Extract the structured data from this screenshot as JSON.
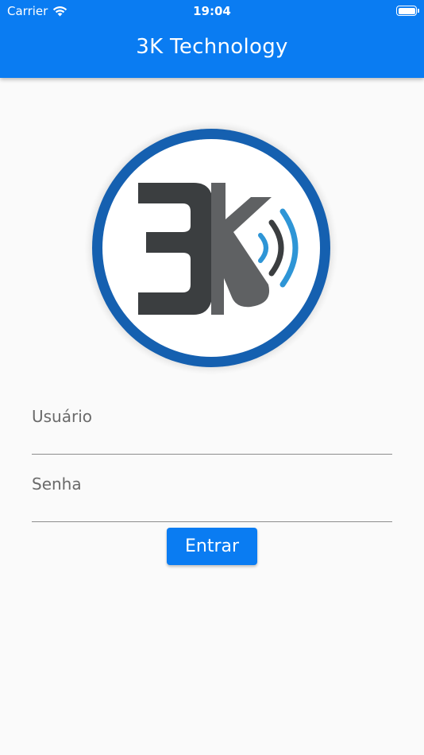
{
  "status_bar": {
    "carrier": "Carrier",
    "time": "19:04",
    "wifi_icon": "wifi-icon",
    "battery_icon": "battery-icon"
  },
  "app_bar": {
    "title": "3K Technology"
  },
  "logo": {
    "text": "3K",
    "icon": "logo-3k-signal"
  },
  "form": {
    "username_label": "Usuário",
    "password_label": "Senha",
    "submit_label": "Entrar"
  },
  "colors": {
    "primary": "#0a7cf2",
    "ring": "#1560b0",
    "logo_dark": "#3b3e40",
    "signal_blue": "#2e95d6",
    "background": "#fafafa"
  }
}
